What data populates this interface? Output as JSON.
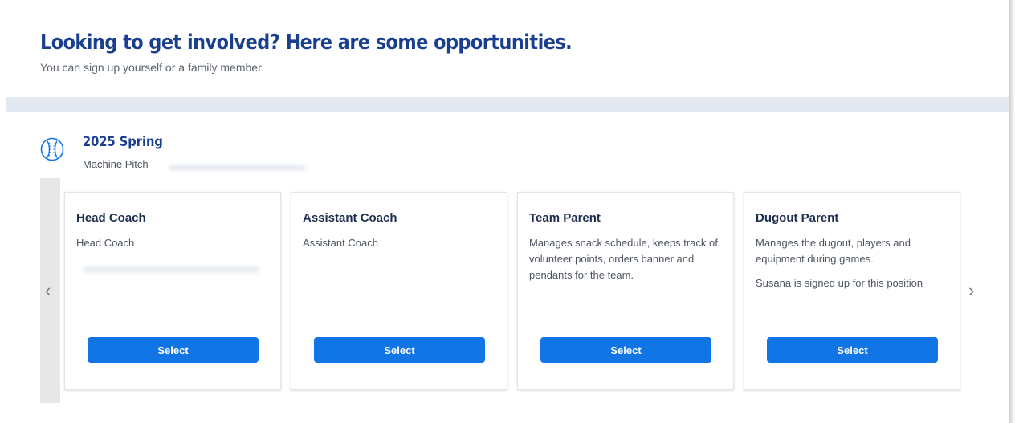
{
  "header": {
    "title": "Looking to get involved? Here are some opportunities.",
    "subtitle": "You can sign up yourself or a family member."
  },
  "season": {
    "icon": "baseball-icon",
    "title": "2025 Spring",
    "division": "Machine Pitch"
  },
  "carousel": {
    "prev_icon": "chevron-left-icon",
    "next_icon": "chevron-right-icon",
    "prev_glyph": "‹",
    "next_glyph": "›"
  },
  "cards": [
    {
      "title": "Head Coach",
      "description": "Head Coach",
      "note": "",
      "button": "Select"
    },
    {
      "title": "Assistant Coach",
      "description": "Assistant Coach",
      "note": "",
      "button": "Select"
    },
    {
      "title": "Team Parent",
      "description": "Manages snack schedule, keeps track of volunteer points, orders banner and pendants for the team.",
      "note": "",
      "button": "Select"
    },
    {
      "title": "Dugout Parent",
      "description": "Manages the dugout, players and equipment during games.",
      "note": "Susana is signed up for this position",
      "button": "Select"
    }
  ],
  "colors": {
    "title": "#1a3f8f",
    "button": "#1175e6",
    "band": "#e3e8f0"
  }
}
